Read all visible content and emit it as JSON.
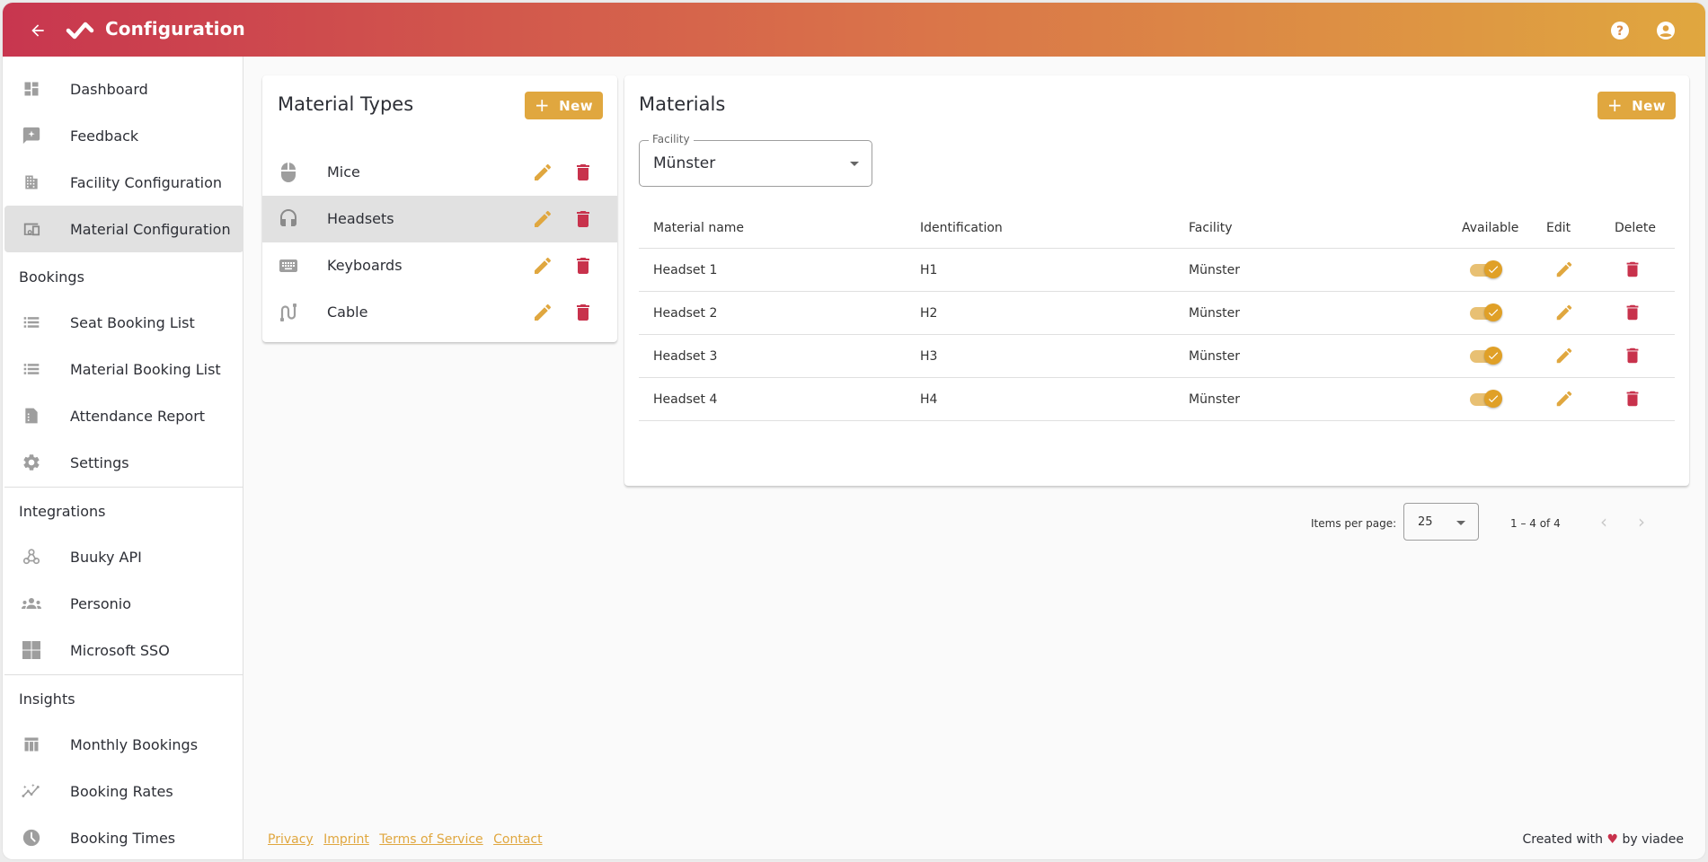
{
  "header": {
    "title": "Configuration",
    "back_icon": "arrow-back-icon",
    "logo_icon": "app-logo-icon",
    "help_icon": "help-icon",
    "account_icon": "account-circle-icon"
  },
  "sidebar": {
    "items": [
      {
        "label": "Dashboard",
        "icon": "dashboard-icon"
      },
      {
        "label": "Feedback",
        "icon": "feedback-icon"
      },
      {
        "label": "Facility Configuration",
        "icon": "building-icon"
      },
      {
        "label": "Material Configuration",
        "icon": "devices-icon",
        "active": true
      }
    ],
    "sections": [
      {
        "title": "Bookings",
        "items": [
          {
            "label": "Seat Booking List",
            "icon": "list-icon"
          },
          {
            "label": "Material Booking List",
            "icon": "list-icon"
          },
          {
            "label": "Attendance Report",
            "icon": "report-icon"
          },
          {
            "label": "Settings",
            "icon": "gear-icon"
          }
        ]
      },
      {
        "title": "Integrations",
        "items": [
          {
            "label": "Buuky API",
            "icon": "webhook-icon"
          },
          {
            "label": "Personio",
            "icon": "groups-icon"
          },
          {
            "label": "Microsoft SSO",
            "icon": "windows-icon"
          }
        ]
      },
      {
        "title": "Insights",
        "items": [
          {
            "label": "Monthly Bookings",
            "icon": "table-chart-icon"
          },
          {
            "label": "Booking Rates",
            "icon": "trending-icon"
          },
          {
            "label": "Booking Times",
            "icon": "clock-icon"
          }
        ]
      }
    ]
  },
  "material_types": {
    "title": "Material Types",
    "new_label": "New",
    "items": [
      {
        "label": "Mice",
        "icon": "mouse-icon"
      },
      {
        "label": "Headsets",
        "icon": "headset-icon",
        "selected": true
      },
      {
        "label": "Keyboards",
        "icon": "keyboard-icon"
      },
      {
        "label": "Cable",
        "icon": "cable-icon"
      }
    ]
  },
  "materials": {
    "title": "Materials",
    "new_label": "New",
    "facility_field": {
      "label": "Facility",
      "value": "Münster"
    },
    "columns": [
      "Material name",
      "Identification",
      "Facility",
      "Available",
      "Edit",
      "Delete"
    ],
    "rows": [
      {
        "name": "Headset 1",
        "id": "H1",
        "facility": "Münster",
        "available": true
      },
      {
        "name": "Headset 2",
        "id": "H2",
        "facility": "Münster",
        "available": true
      },
      {
        "name": "Headset 3",
        "id": "H3",
        "facility": "Münster",
        "available": true
      },
      {
        "name": "Headset 4",
        "id": "H4",
        "facility": "Münster",
        "available": true
      }
    ],
    "paginator": {
      "items_per_page_label": "Items per page:",
      "items_per_page": "25",
      "range": "1 – 4 of 4"
    }
  },
  "footer": {
    "links": [
      "Privacy",
      "Imprint",
      "Terms of Service",
      "Contact"
    ],
    "credit_prefix": "Created with",
    "credit_heart": "♥",
    "credit_suffix": "by viadee"
  },
  "colors": {
    "accent": "#e0a73f",
    "danger": "#c8324c",
    "header_start": "#c8364f",
    "header_end": "#e0a73f"
  }
}
